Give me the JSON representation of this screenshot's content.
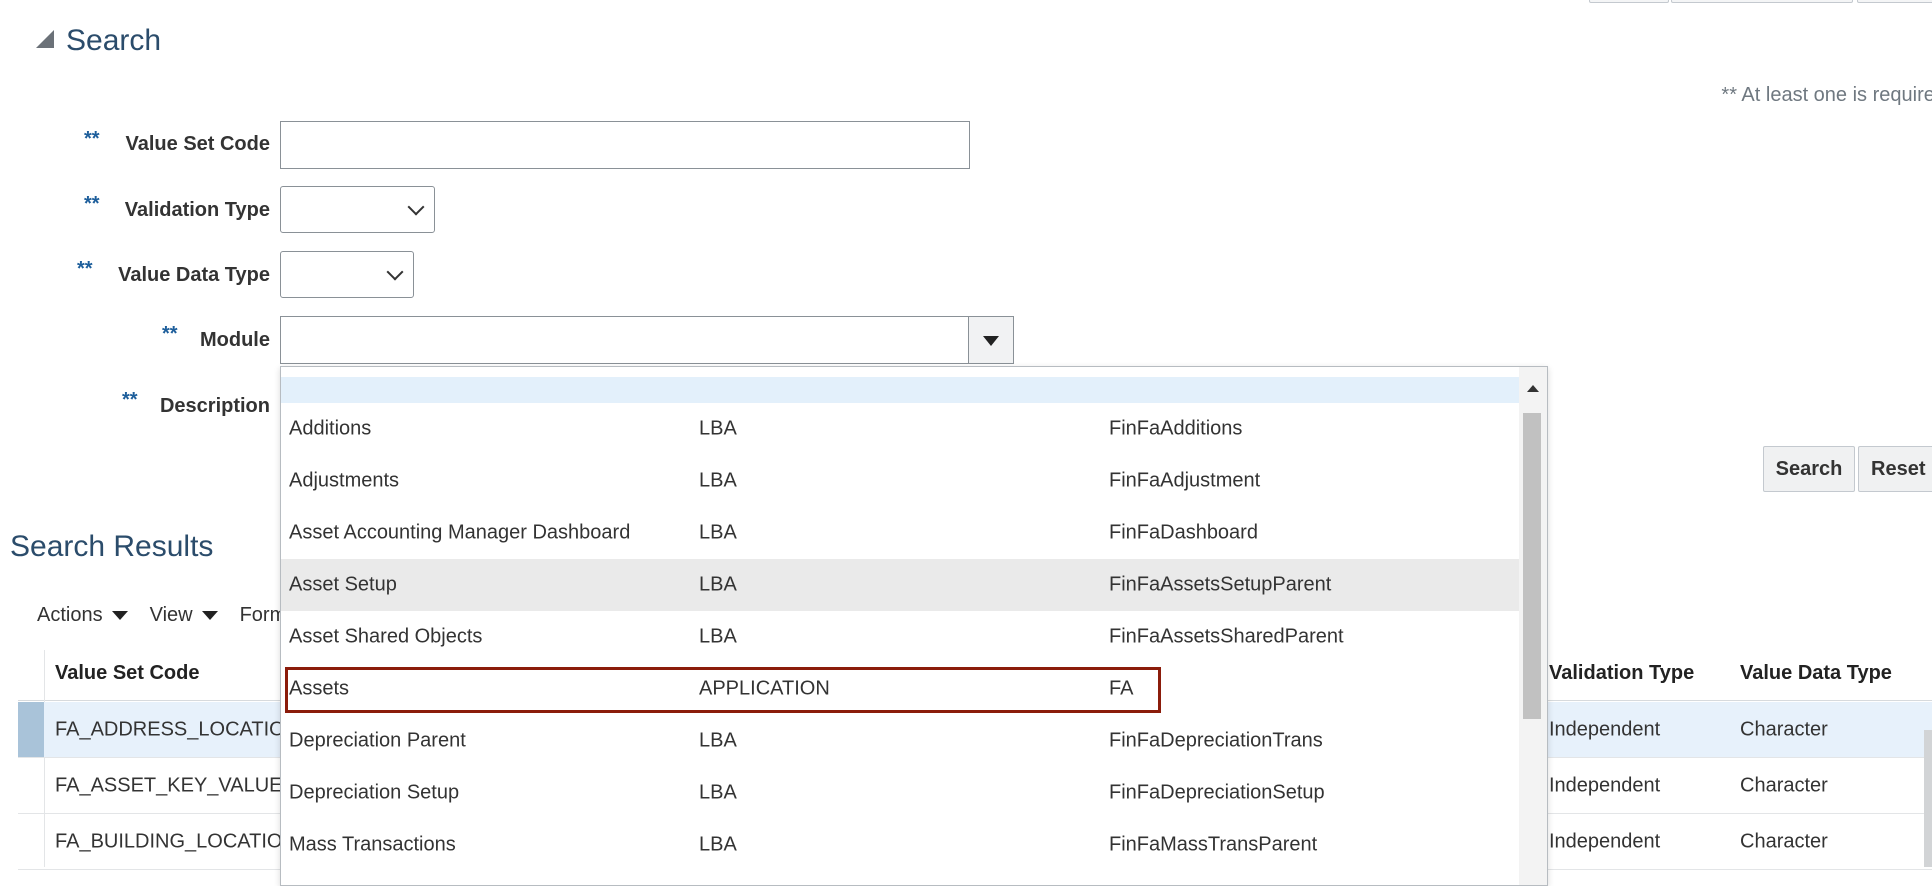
{
  "search": {
    "title": "Search",
    "required_note": "** At least one is required",
    "req_marker": "**",
    "fields": {
      "value_set_code": {
        "label": "Value Set Code",
        "value": ""
      },
      "validation_type": {
        "label": "Validation Type",
        "value": ""
      },
      "value_data_type": {
        "label": "Value Data Type",
        "value": ""
      },
      "module": {
        "label": "Module",
        "value": ""
      },
      "description": {
        "label": "Description",
        "value": ""
      }
    },
    "search_button": "Search",
    "reset_button": "Reset"
  },
  "module_dropdown": {
    "items": [
      {
        "name": "Additions",
        "type": "LBA",
        "code": "FinFaAdditions"
      },
      {
        "name": "Adjustments",
        "type": "LBA",
        "code": "FinFaAdjustment"
      },
      {
        "name": "Asset Accounting Manager Dashboard",
        "type": "LBA",
        "code": "FinFaDashboard"
      },
      {
        "name": "Asset Setup",
        "type": "LBA",
        "code": "FinFaAssetsSetupParent"
      },
      {
        "name": "Asset Shared Objects",
        "type": "LBA",
        "code": "FinFaAssetsSharedParent"
      },
      {
        "name": "Assets",
        "type": "APPLICATION",
        "code": "FA"
      },
      {
        "name": "Depreciation Parent",
        "type": "LBA",
        "code": "FinFaDepreciationTrans"
      },
      {
        "name": "Depreciation Setup",
        "type": "LBA",
        "code": "FinFaDepreciationSetup"
      },
      {
        "name": "Mass Transactions",
        "type": "LBA",
        "code": "FinFaMassTransParent"
      }
    ]
  },
  "results": {
    "title": "Search Results",
    "toolbar": {
      "actions": "Actions",
      "view": "View",
      "format": "Form"
    },
    "columns": {
      "value_set_code": "Value Set Code",
      "validation_type": "Validation Type",
      "value_data_type": "Value Data Type"
    },
    "rows": [
      {
        "code": "FA_ADDRESS_LOCATIO",
        "validation_type": "Independent",
        "data_type": "Character"
      },
      {
        "code": "FA_ASSET_KEY_VALUE",
        "validation_type": "Independent",
        "data_type": "Character"
      },
      {
        "code": "FA_BUILDING_LOCATIO",
        "validation_type": "Independent",
        "data_type": "Character"
      }
    ]
  },
  "colors": {
    "accent_title": "#2b4c6b",
    "required_marker": "#1d5e9b",
    "highlight_box": "#8b1c0b",
    "selected_row": "#e7f1fb"
  }
}
